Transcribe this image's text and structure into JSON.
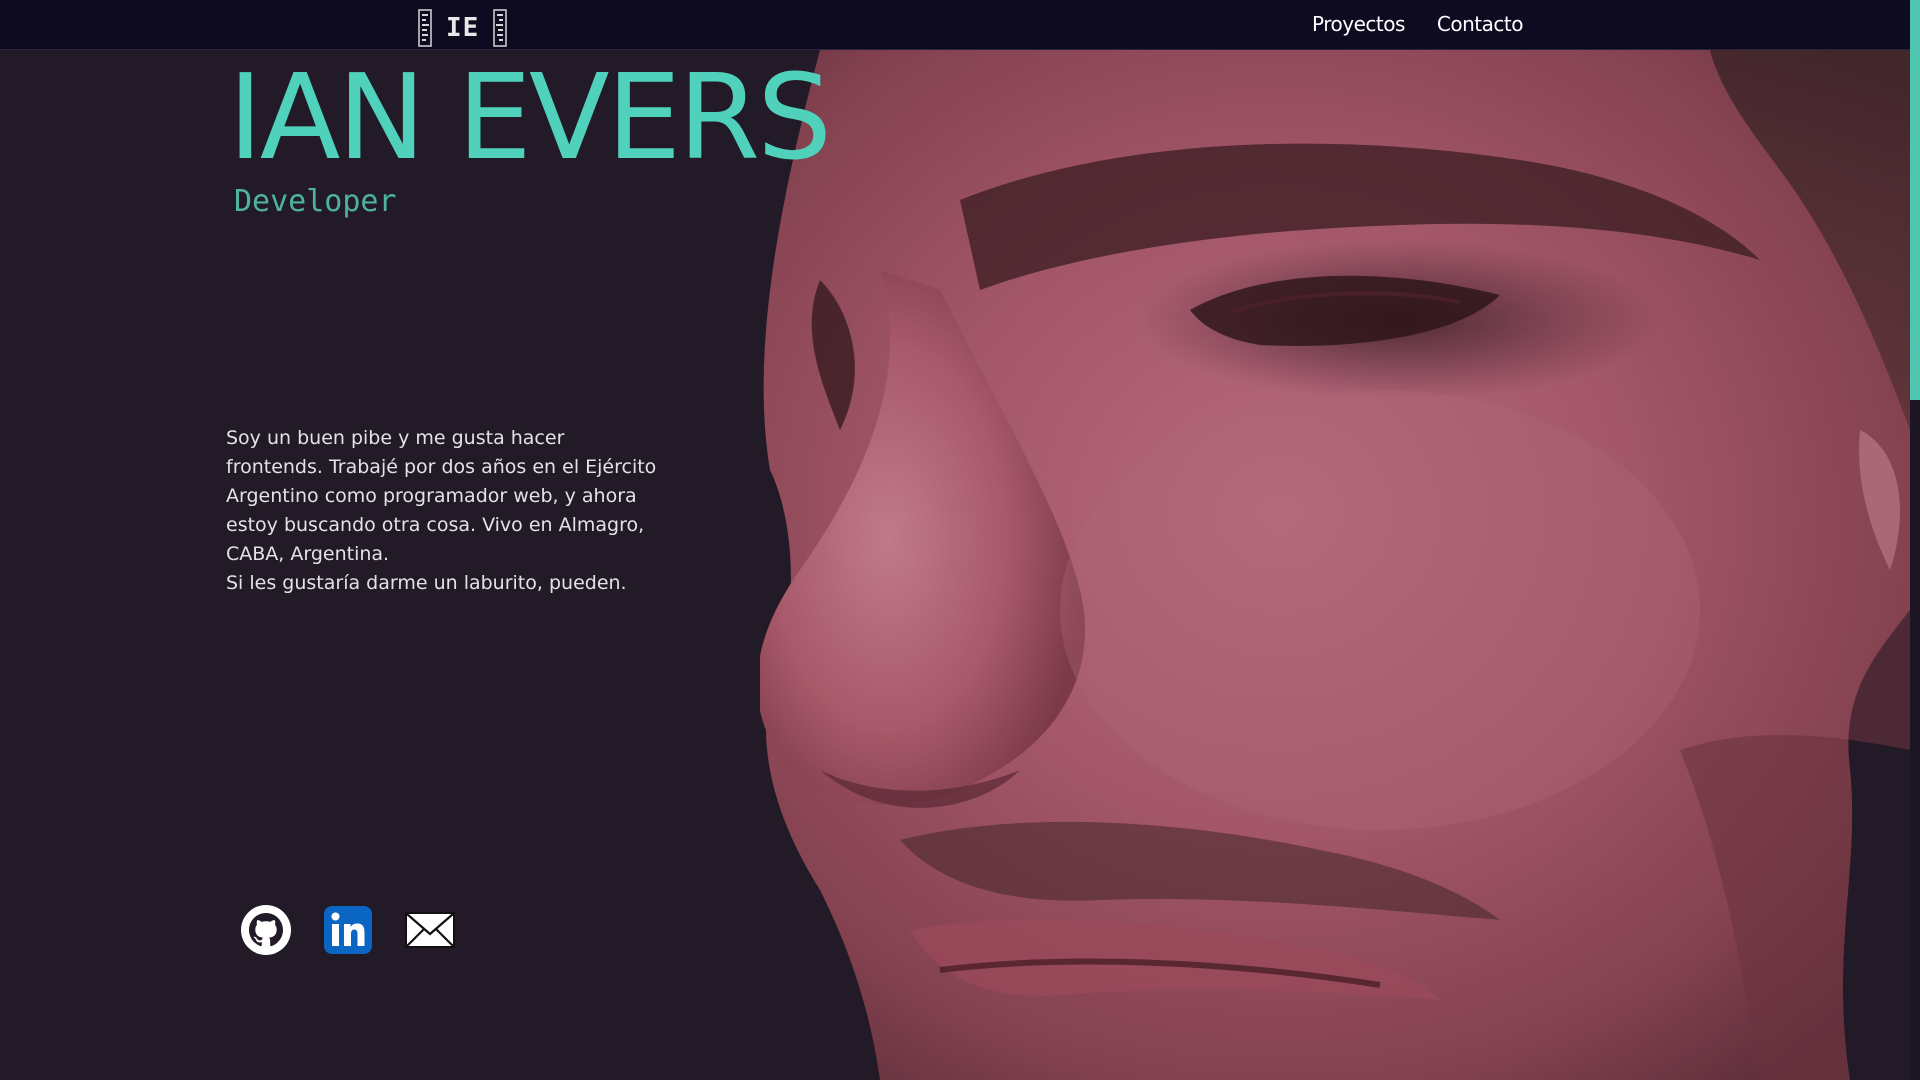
{
  "navbar": {
    "logo_text": "IE",
    "links": [
      {
        "label": "Proyectos"
      },
      {
        "label": "Contacto"
      }
    ]
  },
  "hero": {
    "name": "IAN EVERS",
    "role": "Developer",
    "bio_lines": [
      "Soy un buen pibe y me gusta hacer frontends. Trabajé por dos años en el Ejército Argentino como programador web, y ahora estoy buscando otra cosa. Vivo en Almagro, CABA, Argentina.",
      "Si les gustaría darme un laburito, pueden."
    ]
  },
  "socials": [
    {
      "icon": "github-icon"
    },
    {
      "icon": "linkedin-icon"
    },
    {
      "icon": "mail-icon"
    }
  ],
  "colors": {
    "background": "#221a26",
    "navbar": "#0e0b20",
    "accent": "#4fd1bb",
    "role": "#4db39f",
    "linkedin": "#0a66c2"
  }
}
